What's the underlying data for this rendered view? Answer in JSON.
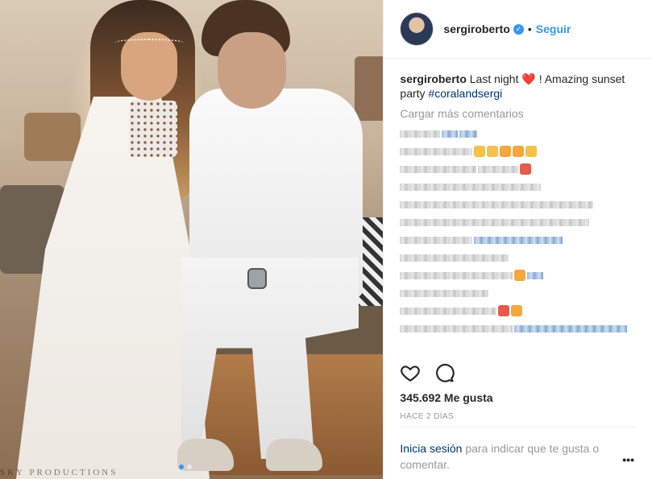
{
  "header": {
    "username": "sergiroberto",
    "separator": "•",
    "follow_label": "Seguir"
  },
  "caption": {
    "username": "sergiroberto",
    "text_before": "Last night",
    "emoji": "❤️",
    "text_after": "! Amazing sunset party",
    "hashtag": "#coralandsergi"
  },
  "comments": {
    "load_more_label": "Cargar más comentarios"
  },
  "photo": {
    "watermark": "SKY PRODUCTIONS",
    "carousel_active_index": 1,
    "carousel_count": 2
  },
  "stats": {
    "likes": "345.692 Me gusta",
    "time": "HACE 2 DÍAS"
  },
  "footer": {
    "login_link": "Inicia sesión",
    "login_text": "para indicar que te gusta o comentar.",
    "more_label": "•••"
  },
  "colors": {
    "link_blue": "#3897f0",
    "hashtag_blue": "#003569",
    "muted_gray": "#999999"
  },
  "icons": [
    "verified-badge-icon",
    "heart-icon",
    "comment-icon",
    "more-options-icon"
  ]
}
